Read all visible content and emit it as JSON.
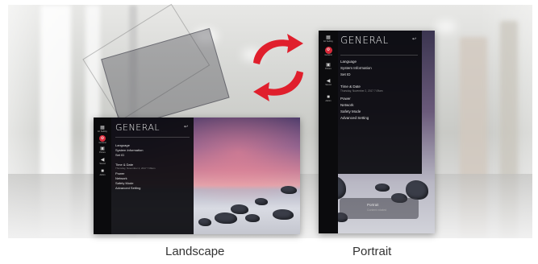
{
  "colors": {
    "accent_red": "#d92a3a",
    "panel_bg": "#0c0c10",
    "caption_text": "#333333"
  },
  "captions": {
    "landscape": "Landscape",
    "portrait": "Portrait"
  },
  "rail": {
    "items": [
      {
        "icon": "ez-setting-icon",
        "label": "Ez Setting"
      },
      {
        "icon": "general-icon",
        "label": "General"
      },
      {
        "icon": "picture-icon",
        "label": "Picture"
      },
      {
        "icon": "sound-icon",
        "label": "Sound"
      },
      {
        "icon": "lock-icon",
        "label": "Admin"
      }
    ]
  },
  "menu": {
    "title": "GENERAL",
    "back_icon": "back-arrow-icon",
    "items": [
      "Language",
      "System Information",
      "Set ID",
      "Time & Date",
      "Power",
      "Network",
      "Safety Mode",
      "Advanced Setting"
    ],
    "time_date_sub": "Thursday, November 2, 2017 7:09am"
  },
  "popup": {
    "line1": "Portrait",
    "line2": "Content rotated"
  }
}
